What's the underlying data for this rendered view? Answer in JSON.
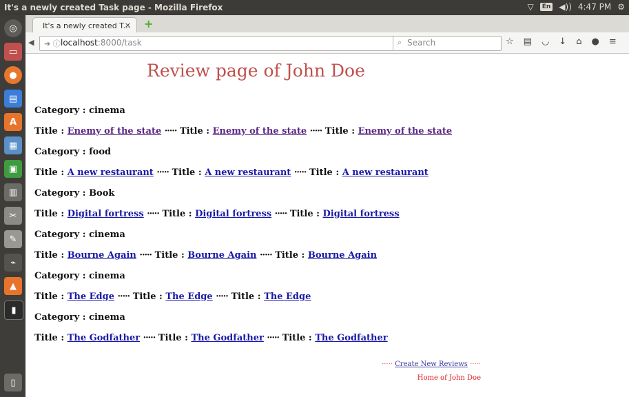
{
  "window": {
    "title": "It's a newly created Task page - Mozilla Firefox"
  },
  "tray": {
    "lang": "En",
    "volume": "◀))",
    "time": "4:47 PM"
  },
  "browser": {
    "tab_label": "It's a newly created T...",
    "tab_close": "×",
    "new_tab": "+",
    "url_host": "localhost",
    "url_rest": ":8000/task",
    "search_placeholder": "Search"
  },
  "page": {
    "heading": "Review page of John Doe",
    "sections": [
      {
        "category": "cinema",
        "title": "Enemy of the state",
        "visited": true
      },
      {
        "category": "food",
        "title": "A new restaurant",
        "visited": false
      },
      {
        "category": "Book",
        "title": "Digital fortress",
        "visited": false
      },
      {
        "category": "cinema",
        "title": "Bourne Again",
        "visited": false
      },
      {
        "category": "cinema",
        "title": "The Edge",
        "visited": false
      },
      {
        "category": "cinema",
        "title": "The Godfather",
        "visited": false
      }
    ],
    "category_prefix": "Category : ",
    "title_prefix": "Title : ",
    "separator": "·····",
    "create_link": "Create New Reviews",
    "home_text": "Home of John Doe"
  },
  "colors": {
    "heading": "#c0504d",
    "link": "#1a1aa6",
    "visited_link": "#5b2a86"
  }
}
